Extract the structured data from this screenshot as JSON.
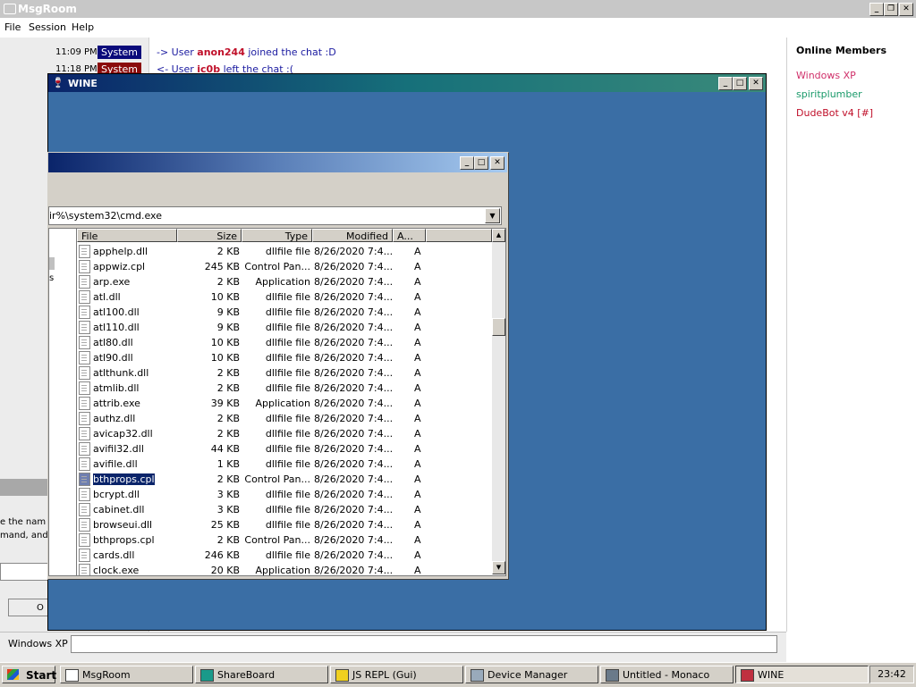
{
  "msgroom": {
    "title": "MsgRoom",
    "menu": [
      "File",
      "Session",
      "Help"
    ],
    "chat": [
      {
        "time": "11:09 PM",
        "tag": "System",
        "tag_color": "#0a0a7a",
        "pre": "-> User ",
        "user": "anon244",
        "post": " joined the chat :D"
      },
      {
        "time": "11:18 PM",
        "tag": "System",
        "tag_color": "#8a0a0a",
        "pre": "<- User ",
        "user": "ic0b",
        "post": " left the chat :("
      }
    ],
    "members_header": "Online Members",
    "members": [
      {
        "name": "Windows XP",
        "color": "#d0306a"
      },
      {
        "name": "spiritplumber",
        "color": "#1a9a6a"
      },
      {
        "name": "DudeBot v4 [#]",
        "color": "#c0102a"
      }
    ],
    "input_label": "Windows XP",
    "left_dialog_lines": [
      "e the nam",
      "mand, and",
      "O"
    ],
    "left_pane_char": "s"
  },
  "wine": {
    "title": "WINE"
  },
  "dialog": {
    "path": "ir%\\system32\\cmd.exe",
    "columns": [
      "File",
      "Size",
      "Type",
      "Modified",
      "A..."
    ],
    "files": [
      {
        "name": "apphelp.dll",
        "size": "2 KB",
        "type": "dllfile file",
        "modified": "8/26/2020 7:4...",
        "attr": "A"
      },
      {
        "name": "appwiz.cpl",
        "size": "245 KB",
        "type": "Control Pan...",
        "modified": "8/26/2020 7:4...",
        "attr": "A"
      },
      {
        "name": "arp.exe",
        "size": "2 KB",
        "type": "Application",
        "modified": "8/26/2020 7:4...",
        "attr": "A"
      },
      {
        "name": "atl.dll",
        "size": "10 KB",
        "type": "dllfile file",
        "modified": "8/26/2020 7:4...",
        "attr": "A"
      },
      {
        "name": "atl100.dll",
        "size": "9 KB",
        "type": "dllfile file",
        "modified": "8/26/2020 7:4...",
        "attr": "A"
      },
      {
        "name": "atl110.dll",
        "size": "9 KB",
        "type": "dllfile file",
        "modified": "8/26/2020 7:4...",
        "attr": "A"
      },
      {
        "name": "atl80.dll",
        "size": "10 KB",
        "type": "dllfile file",
        "modified": "8/26/2020 7:4...",
        "attr": "A"
      },
      {
        "name": "atl90.dll",
        "size": "10 KB",
        "type": "dllfile file",
        "modified": "8/26/2020 7:4...",
        "attr": "A"
      },
      {
        "name": "atlthunk.dll",
        "size": "2 KB",
        "type": "dllfile file",
        "modified": "8/26/2020 7:4...",
        "attr": "A"
      },
      {
        "name": "atmlib.dll",
        "size": "2 KB",
        "type": "dllfile file",
        "modified": "8/26/2020 7:4...",
        "attr": "A"
      },
      {
        "name": "attrib.exe",
        "size": "39 KB",
        "type": "Application",
        "modified": "8/26/2020 7:4...",
        "attr": "A"
      },
      {
        "name": "authz.dll",
        "size": "2 KB",
        "type": "dllfile file",
        "modified": "8/26/2020 7:4...",
        "attr": "A"
      },
      {
        "name": "avicap32.dll",
        "size": "2 KB",
        "type": "dllfile file",
        "modified": "8/26/2020 7:4...",
        "attr": "A"
      },
      {
        "name": "avifil32.dll",
        "size": "44 KB",
        "type": "dllfile file",
        "modified": "8/26/2020 7:4...",
        "attr": "A"
      },
      {
        "name": "avifile.dll",
        "size": "1 KB",
        "type": "dllfile file",
        "modified": "8/26/2020 7:4...",
        "attr": "A"
      },
      {
        "name": "bthprops.cpl",
        "size": "2 KB",
        "type": "Control Pan...",
        "modified": "8/26/2020 7:4...",
        "attr": "A",
        "selected": true
      },
      {
        "name": "bcrypt.dll",
        "size": "3 KB",
        "type": "dllfile file",
        "modified": "8/26/2020 7:4...",
        "attr": "A"
      },
      {
        "name": "cabinet.dll",
        "size": "3 KB",
        "type": "dllfile file",
        "modified": "8/26/2020 7:4...",
        "attr": "A"
      },
      {
        "name": "browseui.dll",
        "size": "25 KB",
        "type": "dllfile file",
        "modified": "8/26/2020 7:4...",
        "attr": "A"
      },
      {
        "name": "bthprops.cpl",
        "size": "2 KB",
        "type": "Control Pan...",
        "modified": "8/26/2020 7:4...",
        "attr": "A"
      },
      {
        "name": "cards.dll",
        "size": "246 KB",
        "type": "dllfile file",
        "modified": "8/26/2020 7:4...",
        "attr": "A"
      },
      {
        "name": "clock.exe",
        "size": "20 KB",
        "type": "Application",
        "modified": "8/26/2020 7:4...",
        "attr": "A"
      }
    ]
  },
  "taskbar": {
    "start_label": "Start",
    "tasks": [
      {
        "label": "MsgRoom",
        "icon": "chat-icon",
        "active": false
      },
      {
        "label": "ShareBoard",
        "icon": "shareboard-icon",
        "active": false
      },
      {
        "label": "JS REPL (Gui)",
        "icon": "js-icon",
        "active": false
      },
      {
        "label": "Device Manager",
        "icon": "device-manager-icon",
        "active": false
      },
      {
        "label": "Untitled - Monaco",
        "icon": "editor-icon",
        "active": false
      },
      {
        "label": "WINE",
        "icon": "wine-icon",
        "active": true
      }
    ],
    "clock": "23:42"
  }
}
